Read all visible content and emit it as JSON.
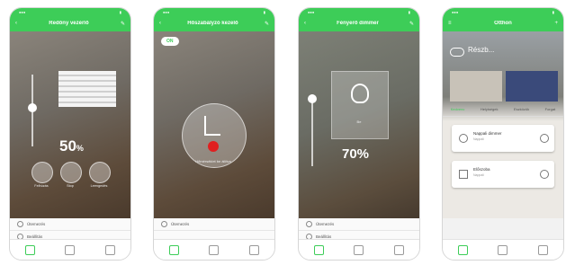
{
  "phones": [
    {
      "title": "Redőny vezérlő",
      "percent": "50",
      "percent_unit": "%",
      "buttons": [
        "Felhúzás",
        "Stop",
        "Leengedés"
      ],
      "list": [
        "Ütemezés",
        "Beállítás"
      ],
      "slider_level": 0.5
    },
    {
      "title": "Hőszabályzó kezelő",
      "chip": "ON",
      "label": "Hőmérséklet be állítva",
      "list": [
        "Ütemezés"
      ]
    },
    {
      "title": "Fényerő dimmer",
      "percent": "70%",
      "tile_label": "Be",
      "list": [
        "Ütemezés",
        "Beállítás"
      ],
      "slider_level": 0.7
    },
    {
      "header": "Otthon",
      "weather": "Részb...",
      "tabs": [
        "Kedvenc",
        "Helyiségek",
        "Eszközök",
        "Forgat"
      ],
      "cards": [
        {
          "name": "Nappali dimmer",
          "sub": "Nappali"
        },
        {
          "name": "Előszoba",
          "sub": "Nappali"
        }
      ]
    }
  ],
  "colors": {
    "accent": "#3dcd58",
    "alert": "#e02020"
  }
}
